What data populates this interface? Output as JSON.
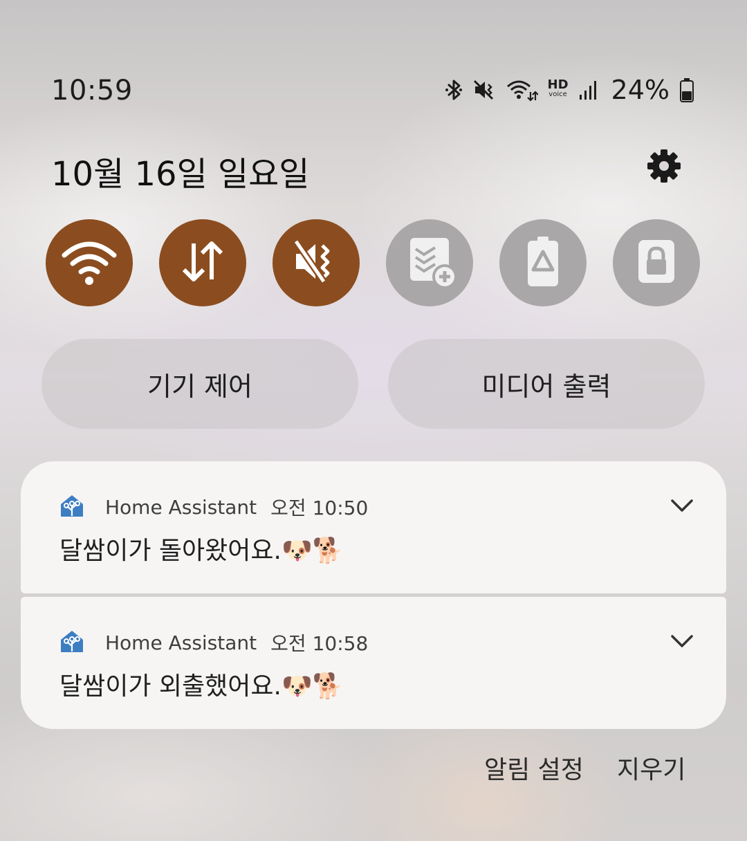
{
  "status_bar": {
    "time": "10:59",
    "hd_label": "HD",
    "voice_label": "voice",
    "battery_percent": "24%",
    "icons": [
      "bluetooth-icon",
      "vibrate-mute-icon",
      "wifi-data-icon",
      "hd-voice-icon",
      "signal-icon",
      "battery-icon"
    ]
  },
  "header": {
    "date": "10월 16일 일요일",
    "settings_icon": "gear-icon"
  },
  "quick_toggles": [
    {
      "icon": "wifi-icon",
      "state": "on"
    },
    {
      "icon": "mobile-data-icon",
      "state": "on"
    },
    {
      "icon": "mute-icon",
      "state": "on"
    },
    {
      "icon": "add-tile-icon",
      "state": "off"
    },
    {
      "icon": "power-saving-icon",
      "state": "off"
    },
    {
      "icon": "secure-folder-icon",
      "state": "off"
    }
  ],
  "colors": {
    "toggle_on": "#8b4d1f",
    "toggle_off": "#a9a7a7",
    "ha_blue": "#3d7ec2"
  },
  "buttons": {
    "device_control": "기기 제어",
    "media_output": "미디어 출력"
  },
  "notifications": [
    {
      "app": "Home Assistant",
      "time": "오전 10:50",
      "message": "달쌈이가 돌아왔어요.🐶🐕"
    },
    {
      "app": "Home Assistant",
      "time": "오전 10:58",
      "message": "달쌈이가 외출했어요.🐶🐕"
    }
  ],
  "footer": {
    "notification_settings": "알림 설정",
    "clear": "지우기"
  }
}
